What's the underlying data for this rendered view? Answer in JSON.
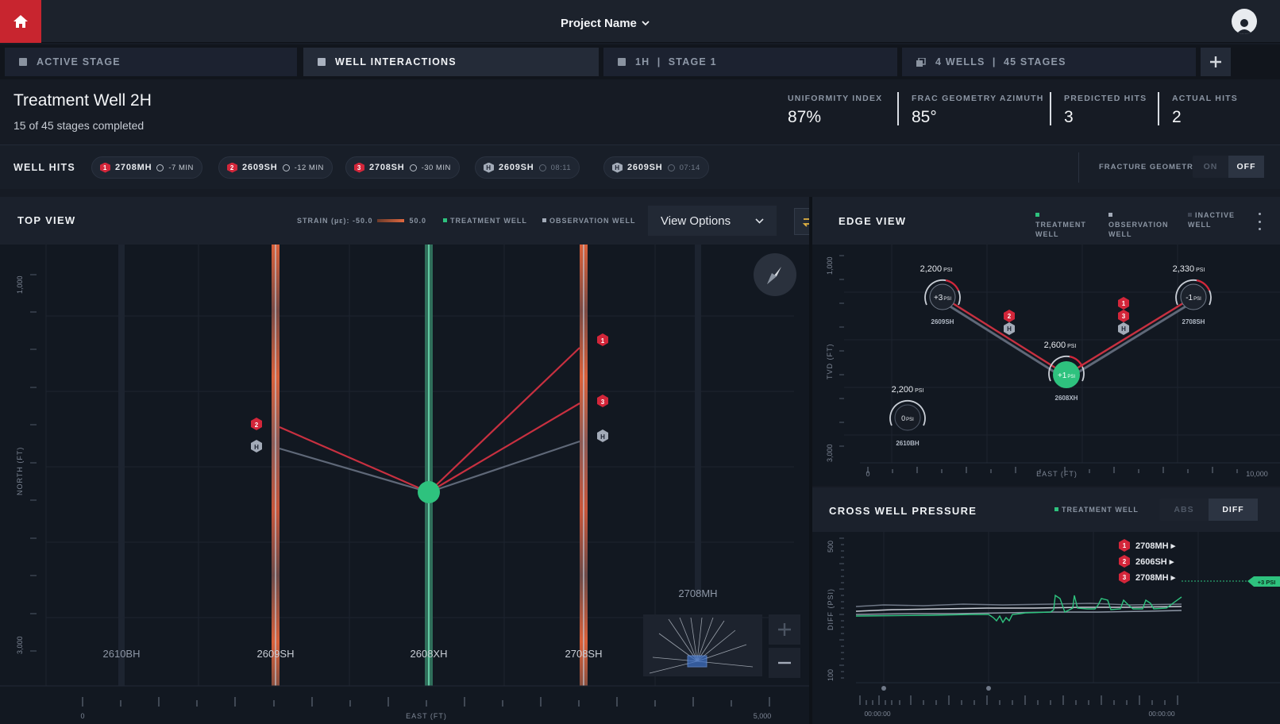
{
  "app": {
    "project_name": "Project Name",
    "home_icon": "home-icon",
    "user_icon": "user-icon"
  },
  "tabs": [
    {
      "label": "ACTIVE STAGE",
      "active": false
    },
    {
      "label": "WELL INTERACTIONS",
      "active": true
    },
    {
      "label": "1H  |  STAGE 1",
      "active": false
    },
    {
      "label": "4 WELLS  |  45 STAGES",
      "active": false
    }
  ],
  "header": {
    "title": "Treatment Well 2H",
    "subtitle": "15 of 45 stages completed",
    "stats": [
      {
        "label": "UNIFORMITY INDEX",
        "value": "87%"
      },
      {
        "label": "FRAC GEOMETRY AZIMUTH",
        "value": "85°"
      },
      {
        "label": "PREDICTED HITS",
        "value": "3"
      },
      {
        "label": "ACTUAL HITS",
        "value": "2"
      }
    ]
  },
  "well_hits": {
    "label": "WELL HITS",
    "chips": [
      {
        "badge": "1",
        "badge_color": "#d3263a",
        "well": "2708MH",
        "time": "-7 MIN",
        "dim": false
      },
      {
        "badge": "2",
        "badge_color": "#d3263a",
        "well": "2609SH",
        "time": "-12 MIN",
        "dim": false
      },
      {
        "badge": "3",
        "badge_color": "#d3263a",
        "well": "2708SH",
        "time": "-30 MIN",
        "dim": false
      },
      {
        "badge": "H",
        "badge_color": "#a3abb8",
        "well": "2609SH",
        "time": "08:11",
        "dim": true
      },
      {
        "badge": "H",
        "badge_color": "#a3abb8",
        "well": "2609SH",
        "time": "07:14",
        "dim": true
      }
    ],
    "fracture_geometry": {
      "label": "FRACTURE GEOMETRY",
      "on": "ON",
      "off": "OFF",
      "selected": "OFF"
    }
  },
  "top_view": {
    "title": "TOP VIEW",
    "strain_label": "STRAIN (µε): -50.0",
    "strain_max": "50.0",
    "legend_treatment": "TREATMENT WELL",
    "legend_observation": "OBSERVATION WELL",
    "view_options": "View Options",
    "y_axis": "NORTH (FT)",
    "y_top": "1,000",
    "y_bottom": "3,000",
    "x_axis": "EAST (FT)",
    "x_min": "0",
    "x_max": "5,000",
    "wells": [
      {
        "name": "2610BH",
        "type": "inactive"
      },
      {
        "name": "2609SH",
        "type": "observation"
      },
      {
        "name": "2608XH",
        "type": "treatment"
      },
      {
        "name": "2708SH",
        "type": "observation"
      },
      {
        "name": "2708MH",
        "type": "inactive"
      }
    ],
    "hit_markers": [
      "2",
      "H",
      "1",
      "3",
      "H"
    ],
    "compass_icon": "compass-icon",
    "zoom_in": "+",
    "zoom_out": "−"
  },
  "edge_view": {
    "title": "EDGE VIEW",
    "legend": [
      "TREATMENT WELL",
      "OBSERVATION WELL",
      "INACTIVE WELL"
    ],
    "y_axis": "TVD (FT)",
    "y_top": "1,000",
    "y_bottom": "3,000",
    "x_axis": "EAST (FT)",
    "x_min": "0",
    "x_max": "10,000",
    "nodes": [
      {
        "well": "2609SH",
        "pressure": "2,200",
        "delta": "+3",
        "type": "observation"
      },
      {
        "well": "2608XH",
        "pressure": "2,600",
        "delta": "+1",
        "type": "treatment"
      },
      {
        "well": "2708SH",
        "pressure": "2,330",
        "delta": "-1",
        "type": "observation"
      },
      {
        "well": "2610BH",
        "pressure": "2,200",
        "delta": "0",
        "type": "inactive"
      }
    ],
    "unit": "PSI",
    "markers": [
      "2",
      "H",
      "1",
      "3",
      "H"
    ]
  },
  "cross_well_pressure": {
    "title": "CROSS WELL PRESSURE",
    "legend": "TREATMENT WELL",
    "abs": "ABS",
    "diff": "DIFF",
    "selected": "DIFF",
    "y_axis": "DIFF (PSI)",
    "y_top": "500",
    "y_bottom": "100",
    "x_min": "00:00:00",
    "x_max": "00:00:00",
    "series": [
      {
        "badge": "1",
        "name": "2708MH ▸"
      },
      {
        "badge": "2",
        "name": "2606SH ▸"
      },
      {
        "badge": "3",
        "name": "2708MH ▸"
      }
    ],
    "current_label": "+3 PSI"
  },
  "colors": {
    "accent_red": "#c8252f",
    "treatment_green": "#2ec27e",
    "hit_red": "#d3263a",
    "observation_grey": "#a3abb8"
  }
}
